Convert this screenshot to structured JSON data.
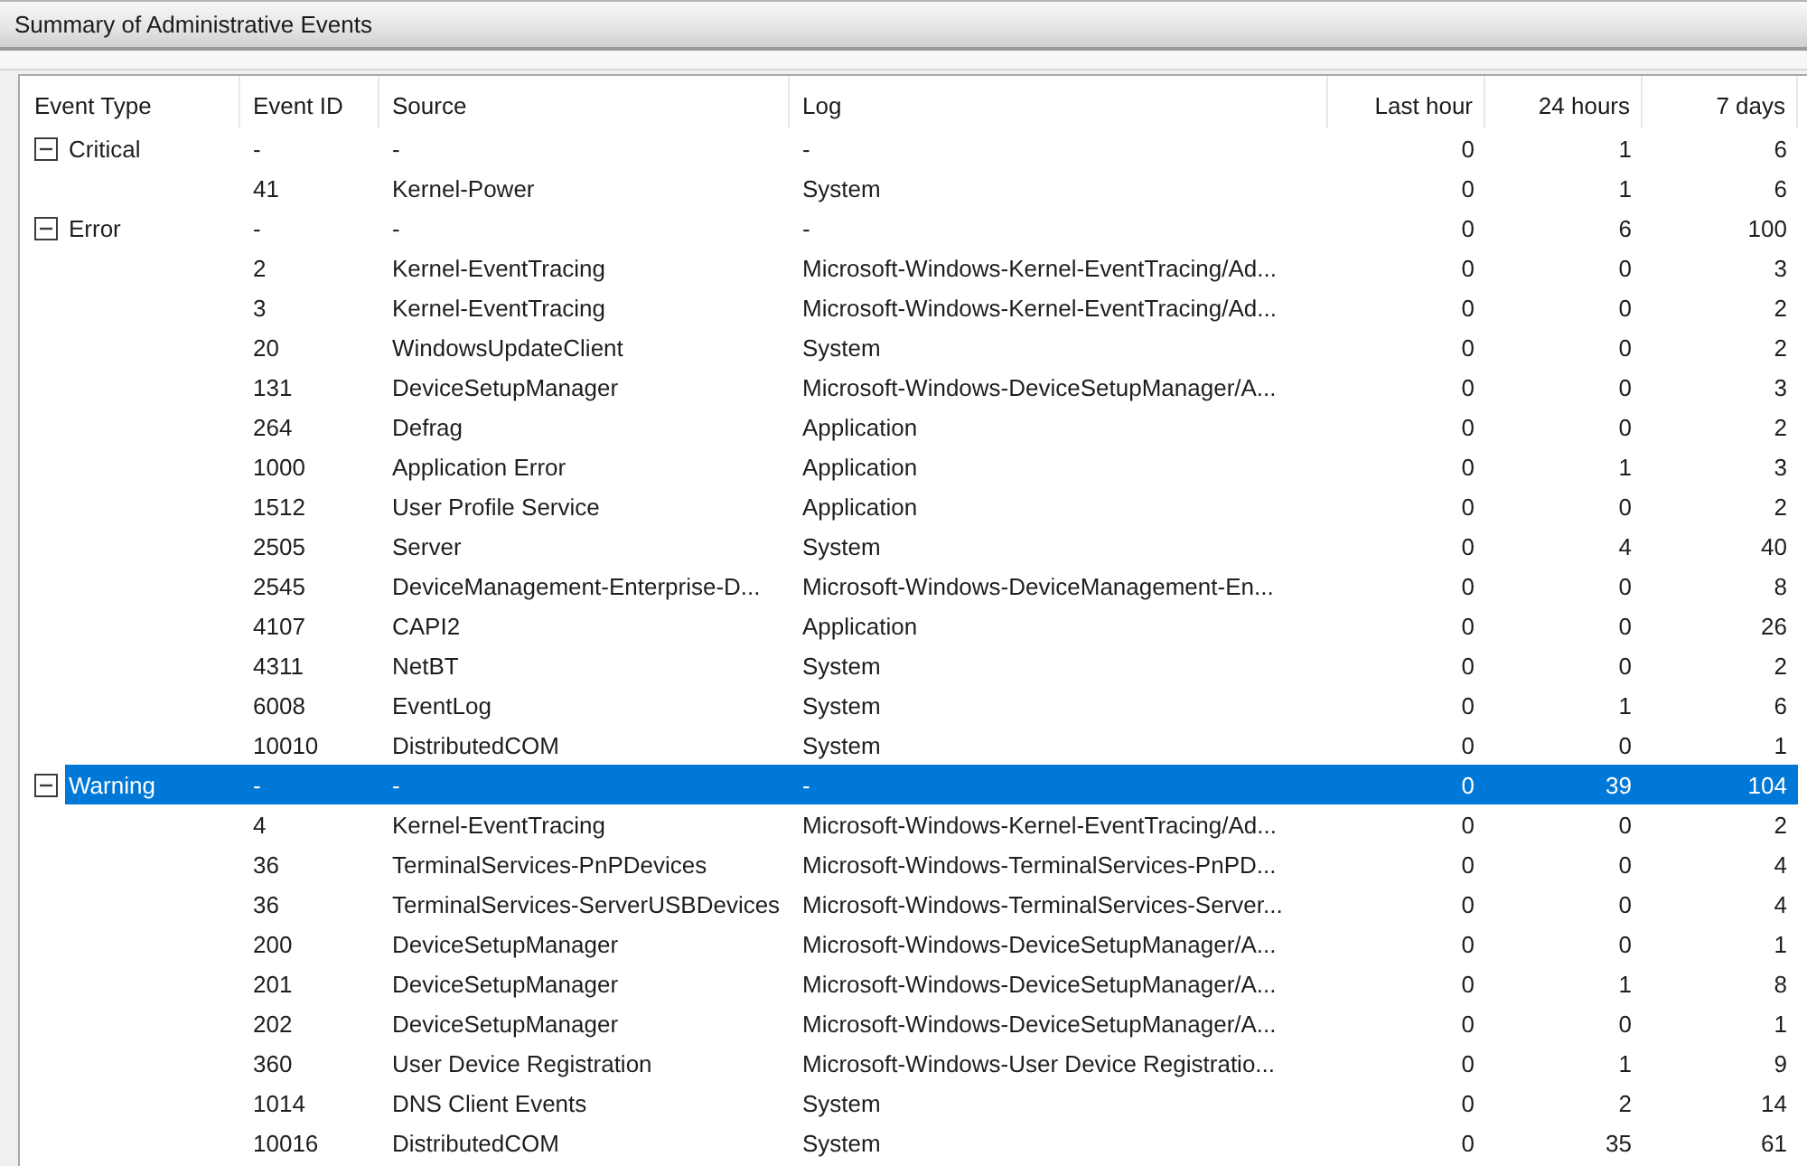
{
  "panel": {
    "title": "Summary of Administrative Events"
  },
  "table": {
    "columns": [
      {
        "label": "Event Type",
        "kind": "text"
      },
      {
        "label": "Event ID",
        "kind": "text"
      },
      {
        "label": "Source",
        "kind": "text"
      },
      {
        "label": "Log",
        "kind": "text"
      },
      {
        "label": "Last hour",
        "kind": "count"
      },
      {
        "label": "24 hours",
        "kind": "count"
      },
      {
        "label": "7 days",
        "kind": "count"
      }
    ],
    "groups": [
      {
        "event_type": "Critical",
        "expanded": true,
        "selected": false,
        "event_id": "-",
        "source": "-",
        "log": "-",
        "last_hour": "0",
        "last_24_hours": "1",
        "last_7_days": "6",
        "children": [
          {
            "event_id": "41",
            "source": "Kernel-Power",
            "log": "System",
            "last_hour": "0",
            "last_24_hours": "1",
            "last_7_days": "6",
            "selected": false
          }
        ]
      },
      {
        "event_type": "Error",
        "expanded": true,
        "selected": false,
        "event_id": "-",
        "source": "-",
        "log": "-",
        "last_hour": "0",
        "last_24_hours": "6",
        "last_7_days": "100",
        "children": [
          {
            "event_id": "2",
            "source": "Kernel-EventTracing",
            "log": "Microsoft-Windows-Kernel-EventTracing/Ad...",
            "last_hour": "0",
            "last_24_hours": "0",
            "last_7_days": "3",
            "selected": false
          },
          {
            "event_id": "3",
            "source": "Kernel-EventTracing",
            "log": "Microsoft-Windows-Kernel-EventTracing/Ad...",
            "last_hour": "0",
            "last_24_hours": "0",
            "last_7_days": "2",
            "selected": false
          },
          {
            "event_id": "20",
            "source": "WindowsUpdateClient",
            "log": "System",
            "last_hour": "0",
            "last_24_hours": "0",
            "last_7_days": "2",
            "selected": false
          },
          {
            "event_id": "131",
            "source": "DeviceSetupManager",
            "log": "Microsoft-Windows-DeviceSetupManager/A...",
            "last_hour": "0",
            "last_24_hours": "0",
            "last_7_days": "3",
            "selected": false
          },
          {
            "event_id": "264",
            "source": "Defrag",
            "log": "Application",
            "last_hour": "0",
            "last_24_hours": "0",
            "last_7_days": "2",
            "selected": false
          },
          {
            "event_id": "1000",
            "source": "Application Error",
            "log": "Application",
            "last_hour": "0",
            "last_24_hours": "1",
            "last_7_days": "3",
            "selected": false
          },
          {
            "event_id": "1512",
            "source": "User Profile Service",
            "log": "Application",
            "last_hour": "0",
            "last_24_hours": "0",
            "last_7_days": "2",
            "selected": false
          },
          {
            "event_id": "2505",
            "source": "Server",
            "log": "System",
            "last_hour": "0",
            "last_24_hours": "4",
            "last_7_days": "40",
            "selected": false
          },
          {
            "event_id": "2545",
            "source": "DeviceManagement-Enterprise-D...",
            "log": "Microsoft-Windows-DeviceManagement-En...",
            "last_hour": "0",
            "last_24_hours": "0",
            "last_7_days": "8",
            "selected": false
          },
          {
            "event_id": "4107",
            "source": "CAPI2",
            "log": "Application",
            "last_hour": "0",
            "last_24_hours": "0",
            "last_7_days": "26",
            "selected": false
          },
          {
            "event_id": "4311",
            "source": "NetBT",
            "log": "System",
            "last_hour": "0",
            "last_24_hours": "0",
            "last_7_days": "2",
            "selected": false
          },
          {
            "event_id": "6008",
            "source": "EventLog",
            "log": "System",
            "last_hour": "0",
            "last_24_hours": "1",
            "last_7_days": "6",
            "selected": false
          },
          {
            "event_id": "10010",
            "source": "DistributedCOM",
            "log": "System",
            "last_hour": "0",
            "last_24_hours": "0",
            "last_7_days": "1",
            "selected": false
          }
        ]
      },
      {
        "event_type": "Warning",
        "expanded": true,
        "selected": true,
        "event_id": "-",
        "source": "-",
        "log": "-",
        "last_hour": "0",
        "last_24_hours": "39",
        "last_7_days": "104",
        "children": [
          {
            "event_id": "4",
            "source": "Kernel-EventTracing",
            "log": "Microsoft-Windows-Kernel-EventTracing/Ad...",
            "last_hour": "0",
            "last_24_hours": "0",
            "last_7_days": "2",
            "selected": false
          },
          {
            "event_id": "36",
            "source": "TerminalServices-PnPDevices",
            "log": "Microsoft-Windows-TerminalServices-PnPD...",
            "last_hour": "0",
            "last_24_hours": "0",
            "last_7_days": "4",
            "selected": false
          },
          {
            "event_id": "36",
            "source": "TerminalServices-ServerUSBDevices",
            "log": "Microsoft-Windows-TerminalServices-Server...",
            "last_hour": "0",
            "last_24_hours": "0",
            "last_7_days": "4",
            "selected": false
          },
          {
            "event_id": "200",
            "source": "DeviceSetupManager",
            "log": "Microsoft-Windows-DeviceSetupManager/A...",
            "last_hour": "0",
            "last_24_hours": "0",
            "last_7_days": "1",
            "selected": false
          },
          {
            "event_id": "201",
            "source": "DeviceSetupManager",
            "log": "Microsoft-Windows-DeviceSetupManager/A...",
            "last_hour": "0",
            "last_24_hours": "1",
            "last_7_days": "8",
            "selected": false
          },
          {
            "event_id": "202",
            "source": "DeviceSetupManager",
            "log": "Microsoft-Windows-DeviceSetupManager/A...",
            "last_hour": "0",
            "last_24_hours": "0",
            "last_7_days": "1",
            "selected": false
          },
          {
            "event_id": "360",
            "source": "User Device Registration",
            "log": "Microsoft-Windows-User Device Registratio...",
            "last_hour": "0",
            "last_24_hours": "1",
            "last_7_days": "9",
            "selected": false
          },
          {
            "event_id": "1014",
            "source": "DNS Client Events",
            "log": "System",
            "last_hour": "0",
            "last_24_hours": "2",
            "last_7_days": "14",
            "selected": false
          },
          {
            "event_id": "10016",
            "source": "DistributedCOM",
            "log": "System",
            "last_hour": "0",
            "last_24_hours": "35",
            "last_7_days": "61",
            "selected": false
          }
        ]
      }
    ]
  }
}
